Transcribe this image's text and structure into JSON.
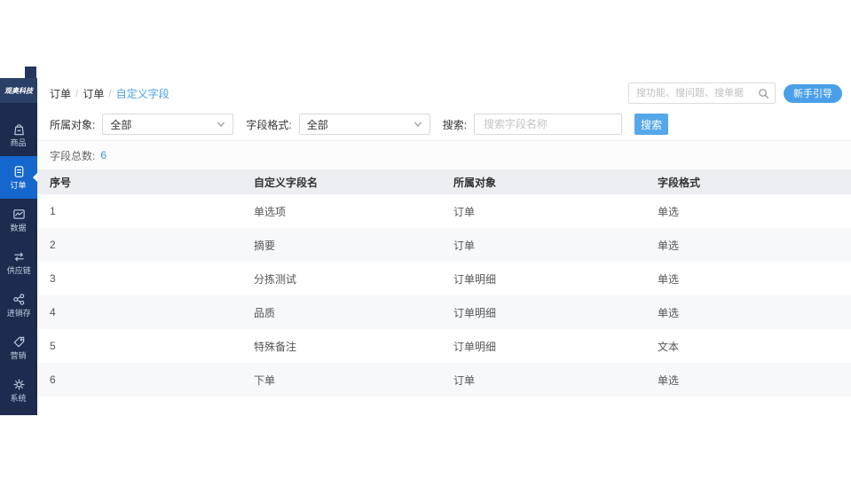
{
  "logo": "观奥科技",
  "sidebar": {
    "items": [
      {
        "label": "商品"
      },
      {
        "label": "订单"
      },
      {
        "label": "数据"
      },
      {
        "label": "供应链"
      },
      {
        "label": "进销存"
      },
      {
        "label": "营销"
      },
      {
        "label": "系统"
      }
    ],
    "active_item": "订单"
  },
  "breadcrumb": {
    "items": [
      "订单",
      "订单",
      "自定义字段"
    ],
    "separator": "/"
  },
  "topbar": {
    "search_placeholder": "搜功能、搜问题、搜单据",
    "guide_button": "新手引导"
  },
  "filters": {
    "owner_label": "所属对象:",
    "owner_value": "全部",
    "format_label": "字段格式:",
    "format_value": "全部",
    "search_label": "搜索:",
    "search_placeholder": "搜索字段名称",
    "search_button": "搜索"
  },
  "summary": {
    "label": "字段总数:",
    "count": "6"
  },
  "table": {
    "headers": [
      "序号",
      "自定义字段名",
      "所属对象",
      "字段格式"
    ],
    "rows": [
      [
        "1",
        "单选项",
        "订单",
        "单选"
      ],
      [
        "2",
        "摘要",
        "订单",
        "单选"
      ],
      [
        "3",
        "分拣测试",
        "订单明细",
        "单选"
      ],
      [
        "4",
        "品质",
        "订单明细",
        "单选"
      ],
      [
        "5",
        "特殊备注",
        "订单明细",
        "文本"
      ],
      [
        "6",
        "下单",
        "订单",
        "单选"
      ]
    ]
  },
  "colors": {
    "sidebar_bg": "#1c2b4e",
    "sidebar_logo_bg": "#2b4066",
    "active_item_bg": "#1566cd",
    "button_blue": "#54a7e8",
    "pill_blue": "#4aa0e8",
    "link_blue": "#4aa0e8",
    "header_row_bg": "#eceef1",
    "alt_row_bg": "#f7f8fa"
  }
}
